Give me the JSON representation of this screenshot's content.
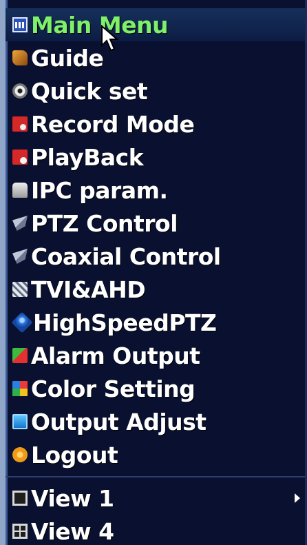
{
  "menu": {
    "title": "Main Menu",
    "items": [
      {
        "label": "Guide",
        "icon": "guide-book-icon"
      },
      {
        "label": "Quick set",
        "icon": "quick-set-disc-icon"
      },
      {
        "label": "Record Mode",
        "icon": "record-mode-icon"
      },
      {
        "label": "PlayBack",
        "icon": "playback-icon"
      },
      {
        "label": "IPC param.",
        "icon": "ipc-camera-icon"
      },
      {
        "label": "PTZ Control",
        "icon": "ptz-camera-icon"
      },
      {
        "label": "Coaxial Control",
        "icon": "coaxial-camera-icon"
      },
      {
        "label": "TVI&AHD",
        "icon": "tvi-ahd-icon"
      },
      {
        "label": "HighSpeedPTZ",
        "icon": "high-speed-ptz-icon"
      },
      {
        "label": "Alarm Output",
        "icon": "alarm-output-icon"
      },
      {
        "label": "Color Setting",
        "icon": "color-setting-icon"
      },
      {
        "label": "Output Adjust",
        "icon": "output-adjust-icon"
      },
      {
        "label": "Logout",
        "icon": "logout-power-icon"
      }
    ],
    "views": [
      {
        "label": "View 1",
        "icon": "single-view-icon",
        "has_submenu": true
      },
      {
        "label": "View 4",
        "icon": "quad-view-icon"
      }
    ]
  },
  "colors": {
    "background": "#0a1030",
    "title_text": "#7ef06a",
    "item_text": "#ffffff"
  }
}
